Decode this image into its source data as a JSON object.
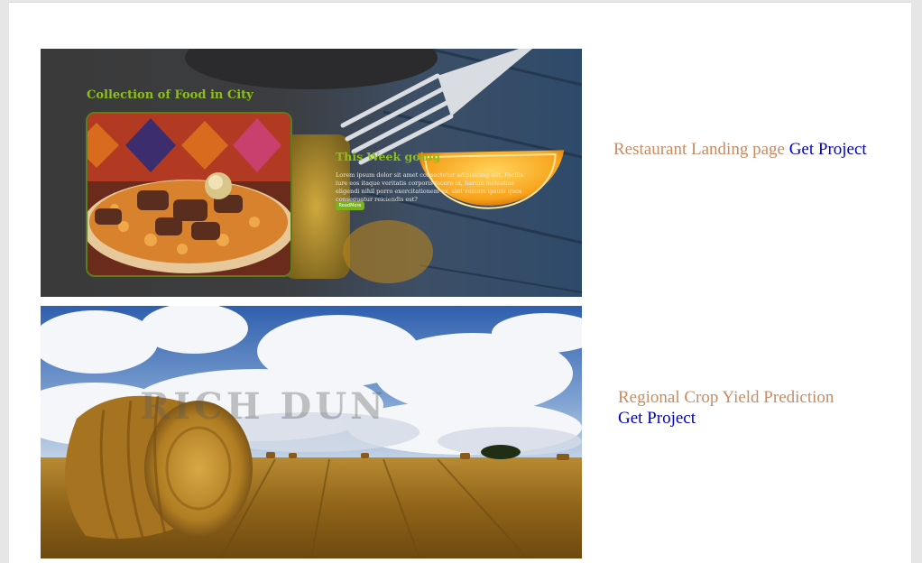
{
  "projects": [
    {
      "title": "Restaurant Landing page",
      "link_label": "Get Project",
      "preview": {
        "heading": "Collection of Food in City",
        "subheading": "This Week going",
        "body": "Lorem ipsum dolor sit amet consectetur adipisicing elit. Facilis iure eos itaque veritatis corporis facere in, harum molestiae eligendi nihil porro exercitationem ex, sint veniam ipsum quos consequatur reiciendis est?",
        "button": "ReadMore"
      }
    },
    {
      "title": "Regional Crop Yield Prediction",
      "link_label": "Get Project",
      "preview": {
        "watermark": "RICH DUN"
      }
    }
  ],
  "colors": {
    "title": "#c98b62",
    "link": "#0000cc",
    "accent_green": "#8cbf1a"
  }
}
